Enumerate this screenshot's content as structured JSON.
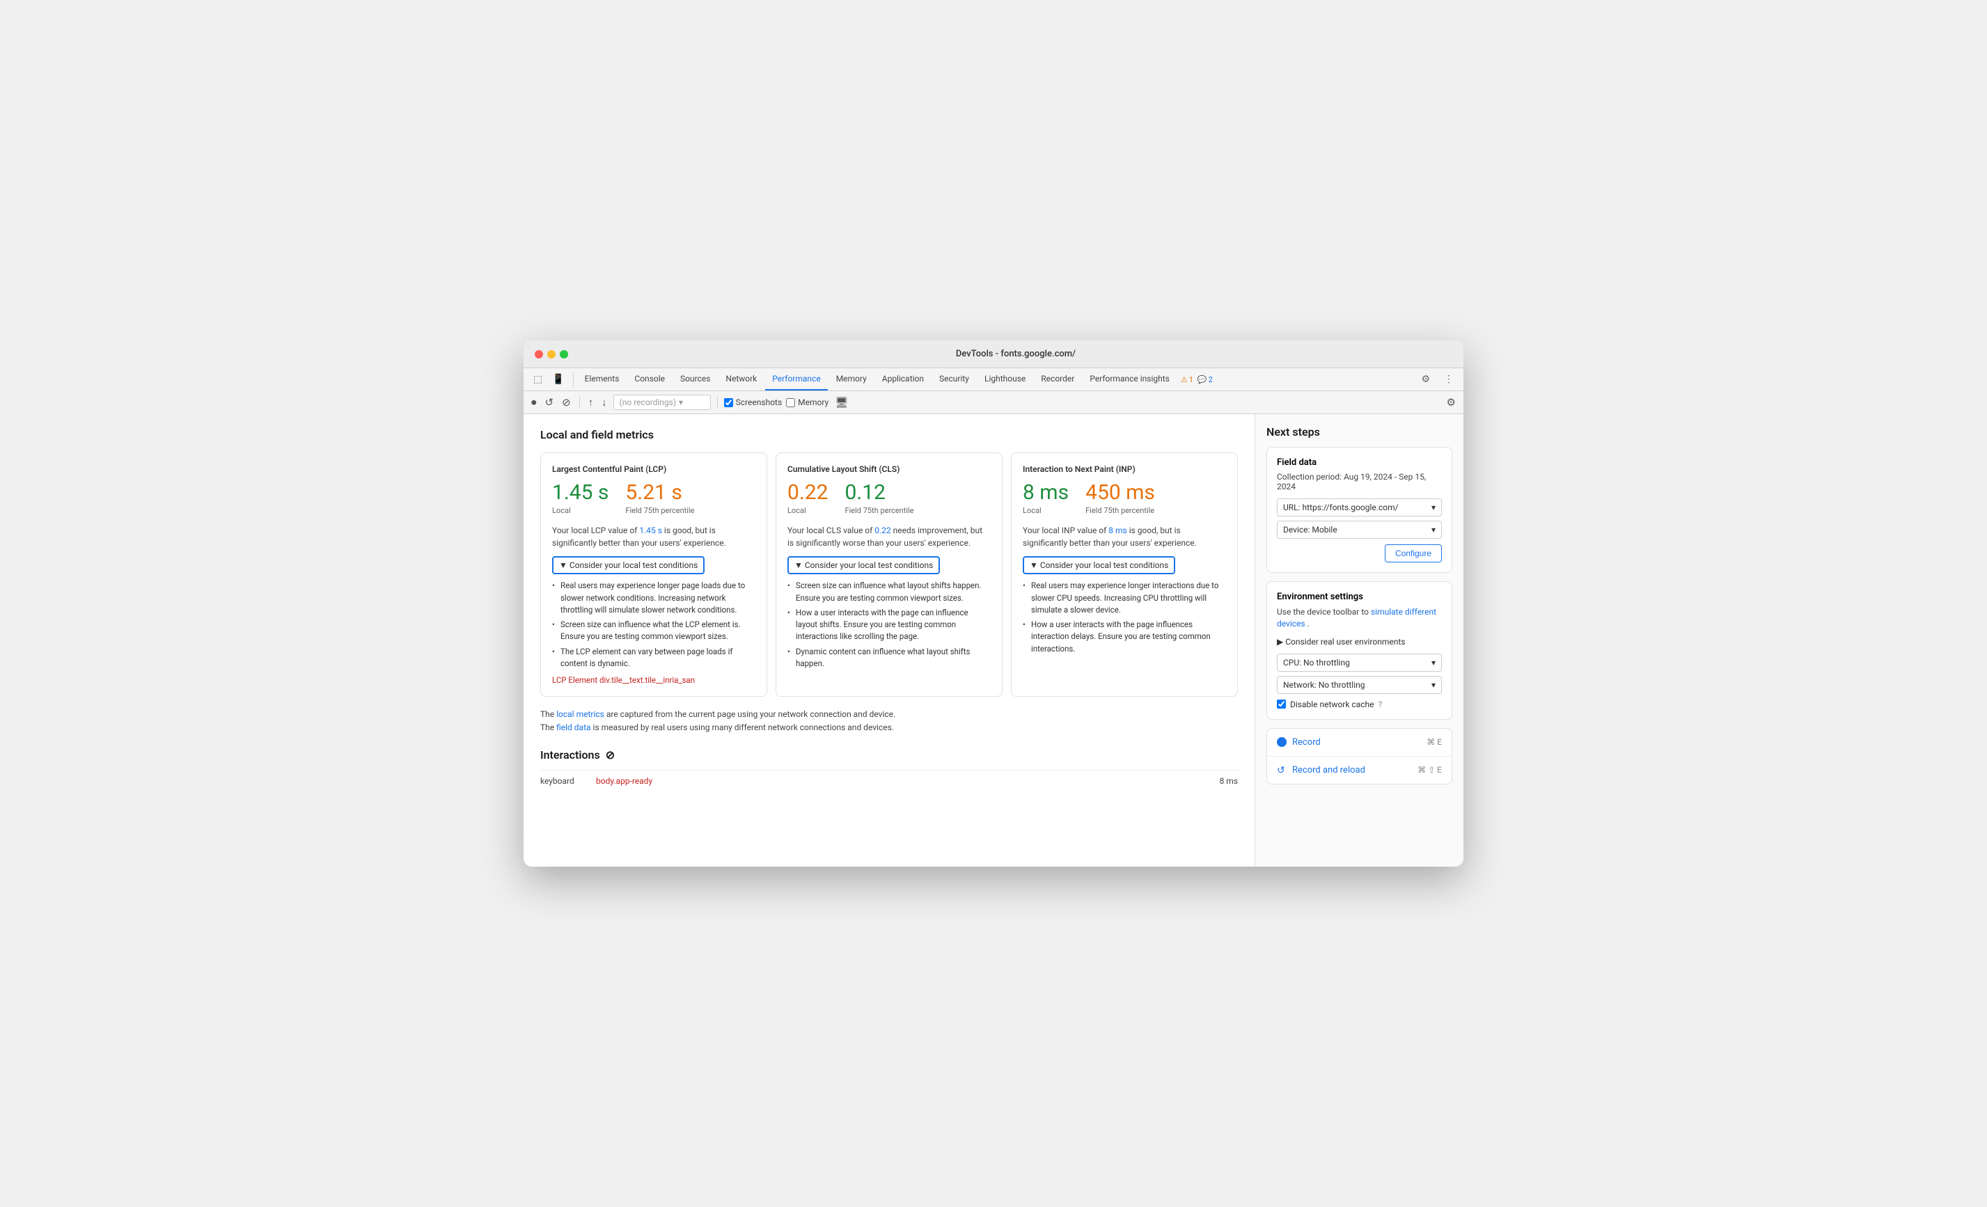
{
  "window": {
    "title": "DevTools - fonts.google.com/",
    "traffic_lights": [
      "red",
      "yellow",
      "green"
    ]
  },
  "devtools_tabs": {
    "tabs": [
      {
        "label": "Elements",
        "active": false
      },
      {
        "label": "Console",
        "active": false
      },
      {
        "label": "Sources",
        "active": false
      },
      {
        "label": "Network",
        "active": false
      },
      {
        "label": "Performance",
        "active": true
      },
      {
        "label": "Memory",
        "active": false
      },
      {
        "label": "Application",
        "active": false
      },
      {
        "label": "Security",
        "active": false
      },
      {
        "label": "Lighthouse",
        "active": false
      },
      {
        "label": "Recorder",
        "active": false
      },
      {
        "label": "Performance insights",
        "active": false
      }
    ],
    "alerts": {
      "warn_count": "1",
      "info_count": "2"
    }
  },
  "toolbar": {
    "recordings_placeholder": "(no recordings)",
    "screenshots_label": "Screenshots",
    "memory_label": "Memory",
    "screenshots_checked": true,
    "memory_checked": false
  },
  "main": {
    "section_title": "Local and field metrics",
    "metrics": [
      {
        "title": "Largest Contentful Paint (LCP)",
        "local_value": "1.45 s",
        "local_color": "green",
        "field_value": "5.21 s",
        "field_color": "orange",
        "field_label": "Field 75th percentile",
        "local_label": "Local",
        "description": "Your local LCP value of 1.45 s is good, but is significantly better than your users' experience.",
        "description_highlight": "1.45 s",
        "consider_label": "▼ Consider your local test conditions",
        "consider_items": [
          "Real users may experience longer page loads due to slower network conditions. Increasing network throttling will simulate slower network conditions.",
          "Screen size can influence what the LCP element is. Ensure you are testing common viewport sizes.",
          "The LCP element can vary between page loads if content is dynamic."
        ],
        "lcp_element_label": "LCP Element",
        "lcp_element_value": "div.tile__text.tile__inria_san"
      },
      {
        "title": "Cumulative Layout Shift (CLS)",
        "local_value": "0.22",
        "local_color": "orange",
        "field_value": "0.12",
        "field_color": "green",
        "field_label": "Field 75th percentile",
        "local_label": "Local",
        "description": "Your local CLS value of 0.22 needs improvement, but is significantly worse than your users' experience.",
        "description_highlight": "0.22",
        "consider_label": "▼ Consider your local test conditions",
        "consider_items": [
          "Screen size can influence what layout shifts happen. Ensure you are testing common viewport sizes.",
          "How a user interacts with the page can influence layout shifts. Ensure you are testing common interactions like scrolling the page.",
          "Dynamic content can influence what layout shifts happen."
        ]
      },
      {
        "title": "Interaction to Next Paint (INP)",
        "local_value": "8 ms",
        "local_color": "green",
        "field_value": "450 ms",
        "field_color": "orange",
        "field_label": "Field 75th percentile",
        "local_label": "Local",
        "description": "Your local INP value of 8 ms is good, but is significantly better than your users' experience.",
        "description_highlight": "8 ms",
        "consider_label": "▼ Consider your local test conditions",
        "consider_items": [
          "Real users may experience longer interactions due to slower CPU speeds. Increasing CPU throttling will simulate a slower device.",
          "How a user interacts with the page influences interaction delays. Ensure you are testing common interactions."
        ]
      }
    ],
    "footer_note_1": "The local metrics are captured from the current page using your network connection and device.",
    "footer_note_1_link": "local metrics",
    "footer_note_2": "The field data is measured by real users using many different network connections and devices.",
    "footer_note_2_link": "field data",
    "interactions_title": "Interactions",
    "interactions_icon": "⊘",
    "interactions": [
      {
        "type": "keyboard",
        "selector": "body.app-ready",
        "duration": "8 ms"
      }
    ]
  },
  "right_panel": {
    "title": "Next steps",
    "field_data": {
      "title": "Field data",
      "period": "Collection period: Aug 19, 2024 - Sep 15, 2024",
      "url_label": "URL: https://fonts.google.com/",
      "device_label": "Device: Mobile",
      "configure_label": "Configure"
    },
    "environment": {
      "title": "Environment settings",
      "description_1": "Use the device toolbar to",
      "description_link": "simulate different devices",
      "description_2": ".",
      "consider_label": "▶ Consider real user environments",
      "cpu_label": "CPU: No throttling",
      "network_label": "Network: No throttling",
      "disable_cache_label": "Disable network cache"
    },
    "record": {
      "label": "Record",
      "shortcut": "⌘ E"
    },
    "record_reload": {
      "label": "Record and reload",
      "shortcut": "⌘ ⇧ E"
    }
  }
}
